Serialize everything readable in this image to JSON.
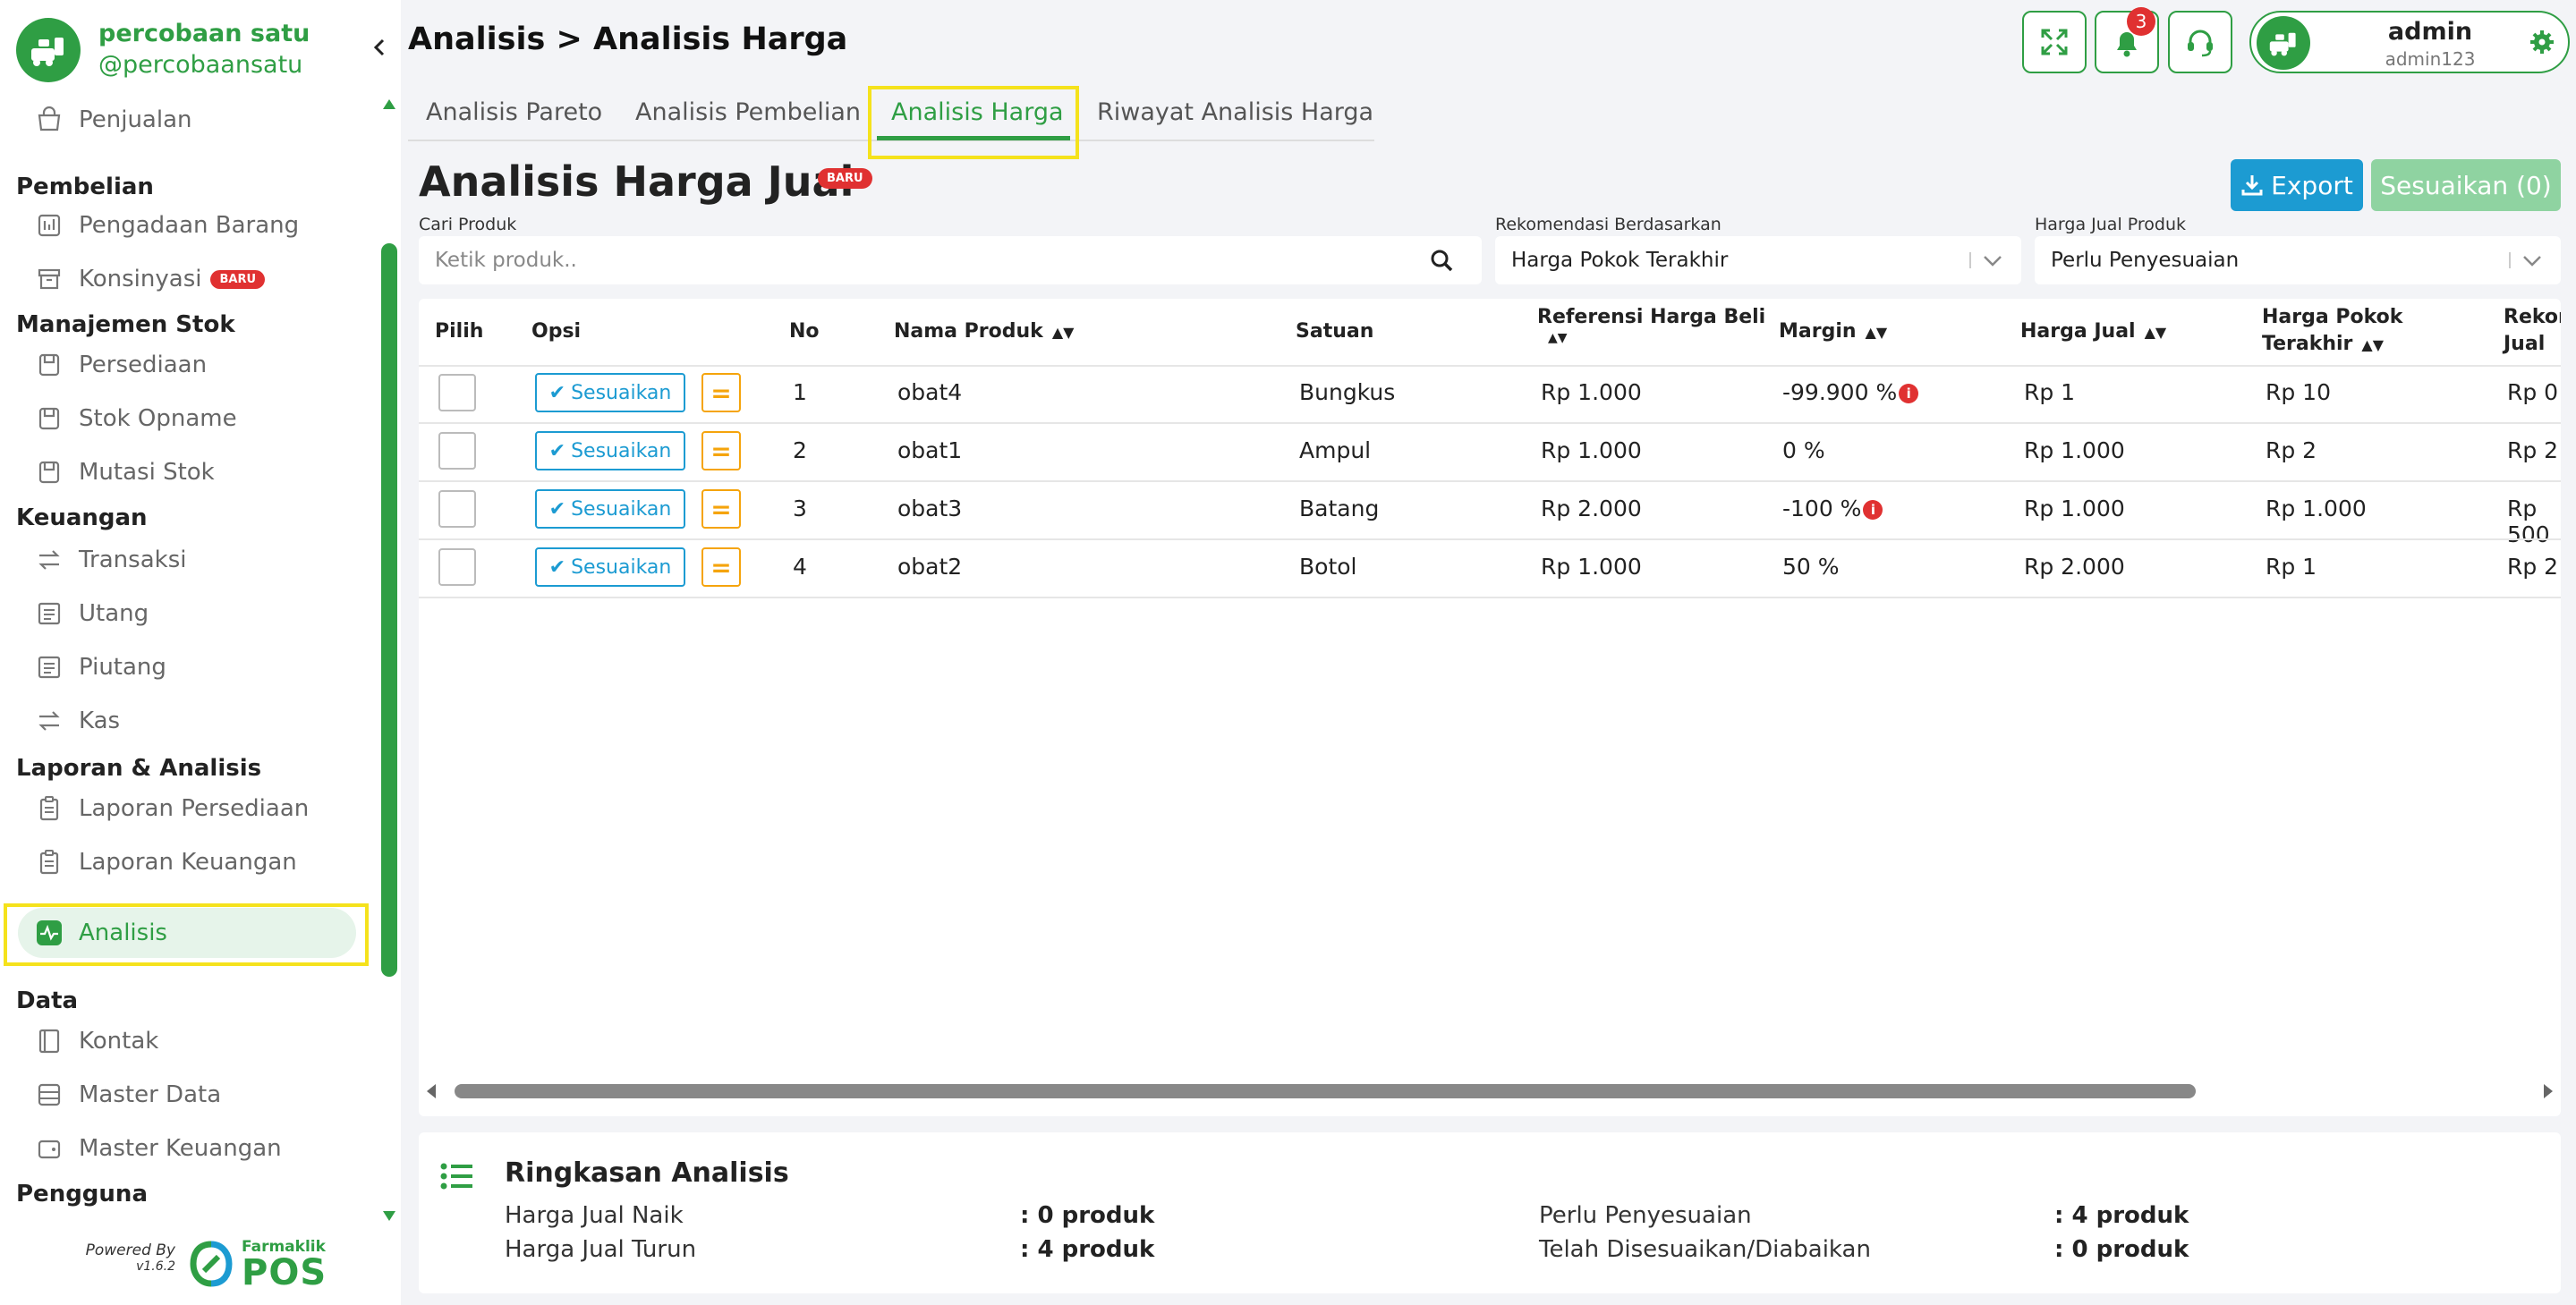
{
  "store": {
    "name": "percobaan satu",
    "handle": "@percobaansatu"
  },
  "header": {
    "title": "Analisis > Analisis Harga",
    "notif_count": "3"
  },
  "user": {
    "name": "admin",
    "username": "admin123"
  },
  "sidebar": {
    "items": [
      {
        "label": "Penjualan",
        "icon": "cart-icon"
      },
      {
        "group": "Pembelian"
      },
      {
        "label": "Pengadaan Barang",
        "icon": "receipt-icon"
      },
      {
        "label": "Konsinyasi",
        "icon": "archive-icon",
        "badge": "BARU"
      },
      {
        "group": "Manajemen Stok"
      },
      {
        "label": "Persediaan",
        "icon": "box-icon"
      },
      {
        "label": "Stok Opname",
        "icon": "box-icon"
      },
      {
        "label": "Mutasi Stok",
        "icon": "box-icon"
      },
      {
        "group": "Keuangan"
      },
      {
        "label": "Transaksi",
        "icon": "transfer-icon"
      },
      {
        "label": "Utang",
        "icon": "ledger-icon"
      },
      {
        "label": "Piutang",
        "icon": "ledger-icon"
      },
      {
        "label": "Kas",
        "icon": "transfer-icon"
      },
      {
        "group": "Laporan & Analisis"
      },
      {
        "label": "Laporan Persediaan",
        "icon": "clipboard-icon"
      },
      {
        "label": "Laporan Keuangan",
        "icon": "clipboard-icon"
      },
      {
        "label": "Analisis",
        "icon": "activity-icon",
        "active": true
      },
      {
        "group": "Data"
      },
      {
        "label": "Kontak",
        "icon": "contact-icon"
      },
      {
        "label": "Master Data",
        "icon": "database-icon"
      },
      {
        "label": "Master Keuangan",
        "icon": "wallet-icon"
      },
      {
        "group": "Pengguna"
      }
    ],
    "powered_by": "Powered By",
    "version": "v1.6.2",
    "brand_small": "Farmaklik",
    "brand_big": "POS"
  },
  "tabs": [
    "Analisis Pareto",
    "Analisis Pembelian",
    "Analisis Harga",
    "Riwayat Analisis Harga"
  ],
  "section": {
    "title": "Analisis Harga Jual",
    "badge": "BARU",
    "export_label": "Export",
    "adjust_all_label": "Sesuaikan (0)"
  },
  "filters": {
    "search_label": "Cari Produk",
    "search_placeholder": "Ketik produk..",
    "rekomendasi_label": "Rekomendasi Berdasarkan",
    "rekomendasi_value": "Harga Pokok Terakhir",
    "harga_label": "Harga Jual Produk",
    "harga_value": "Perlu Penyesuaian"
  },
  "table": {
    "headers": {
      "pilih": "Pilih",
      "opsi": "Opsi",
      "no": "No",
      "nama": "Nama Produk",
      "satuan": "Satuan",
      "ref_beli": "Referensi Harga Beli",
      "margin": "Margin",
      "harga_jual": "Harga Jual",
      "harga_pokok_1": "Harga Pokok",
      "harga_pokok_2": "Terakhir",
      "rekom_1": "Rekomendasi",
      "rekom_2": "Jual"
    },
    "action_label": "Sesuaikan",
    "rows": [
      {
        "no": "1",
        "nama": "obat4",
        "satuan": "Bungkus",
        "ref_beli": "Rp 1.000",
        "margin": "-99.900 %",
        "warn": true,
        "harga_jual": "Rp 1",
        "harga_pokok": "Rp 10",
        "rekom": "Rp 0"
      },
      {
        "no": "2",
        "nama": "obat1",
        "satuan": "Ampul",
        "ref_beli": "Rp 1.000",
        "margin": "0 %",
        "warn": false,
        "harga_jual": "Rp 1.000",
        "harga_pokok": "Rp 2",
        "rekom": "Rp 2"
      },
      {
        "no": "3",
        "nama": "obat3",
        "satuan": "Batang",
        "ref_beli": "Rp 2.000",
        "margin": "-100 %",
        "warn": true,
        "harga_jual": "Rp 1.000",
        "harga_pokok": "Rp 1.000",
        "rekom": "Rp 500"
      },
      {
        "no": "4",
        "nama": "obat2",
        "satuan": "Botol",
        "ref_beli": "Rp 1.000",
        "margin": "50 %",
        "warn": false,
        "harga_jual": "Rp 2.000",
        "harga_pokok": "Rp 1",
        "rekom": "Rp 2"
      }
    ]
  },
  "summary": {
    "title": "Ringkasan Analisis",
    "naik_label": "Harga Jual Naik",
    "naik_value": ": 0 produk",
    "turun_label": "Harga Jual Turun",
    "turun_value": ": 4 produk",
    "perlu_label": "Perlu Penyesuaian",
    "perlu_value": ": 4 produk",
    "telah_label": "Telah Disesuaikan/Diabaikan",
    "telah_value": ": 0 produk"
  },
  "colors": {
    "accent": "#2f9e44",
    "highlight": "#f5e21c",
    "export": "#1c9bd2",
    "danger": "#e03131",
    "warning": "#f5a40c"
  }
}
